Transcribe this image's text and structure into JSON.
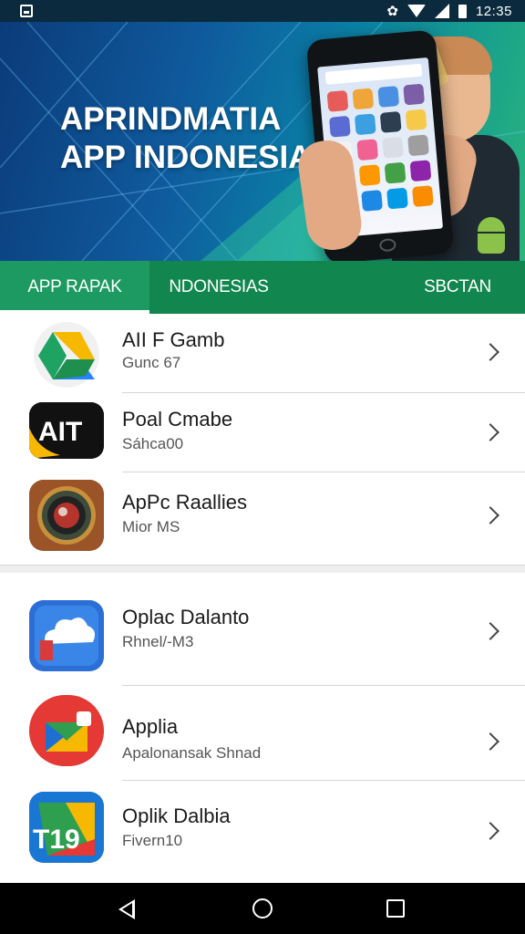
{
  "status_bar": {
    "time": "12:35",
    "icons": [
      "notification-icon",
      "settings-gear-icon",
      "wifi-icon",
      "signal-icon",
      "battery-icon"
    ]
  },
  "hero": {
    "title_line1": "APRINDMATIA",
    "title_line2": "APP INDONESIA"
  },
  "tabs": [
    {
      "label": "APP RAPAK",
      "selected": true
    },
    {
      "label": "NDONESIAS",
      "selected": false
    },
    {
      "label": "SBCTAN",
      "selected": false
    }
  ],
  "list": {
    "items": [
      {
        "title": "AII F Gamb",
        "subtitle": "Gunc 67",
        "icon": "drive-triangle-icon"
      },
      {
        "title": "Poal Cmabe",
        "subtitle": "Sáhca00",
        "icon": "ait-logo-icon"
      },
      {
        "title": "ApPc Raallies",
        "subtitle": "Mior MS",
        "icon": "camera-lens-icon"
      },
      {
        "title": "Oplac Dalanto",
        "subtitle": "Rhnel/-M3",
        "icon": "cloud-map-icon"
      },
      {
        "title": "Applia",
        "subtitle": "Apalonansak Shnad",
        "icon": "envelope-app-icon"
      },
      {
        "title": "Oplik Dalbia",
        "subtitle": "Fivern10",
        "icon": "t19-app-icon"
      }
    ]
  },
  "colors": {
    "tab_bar": "#12864f",
    "tab_selected": "#1d9a61",
    "status_bar": "#0c2a3e"
  }
}
